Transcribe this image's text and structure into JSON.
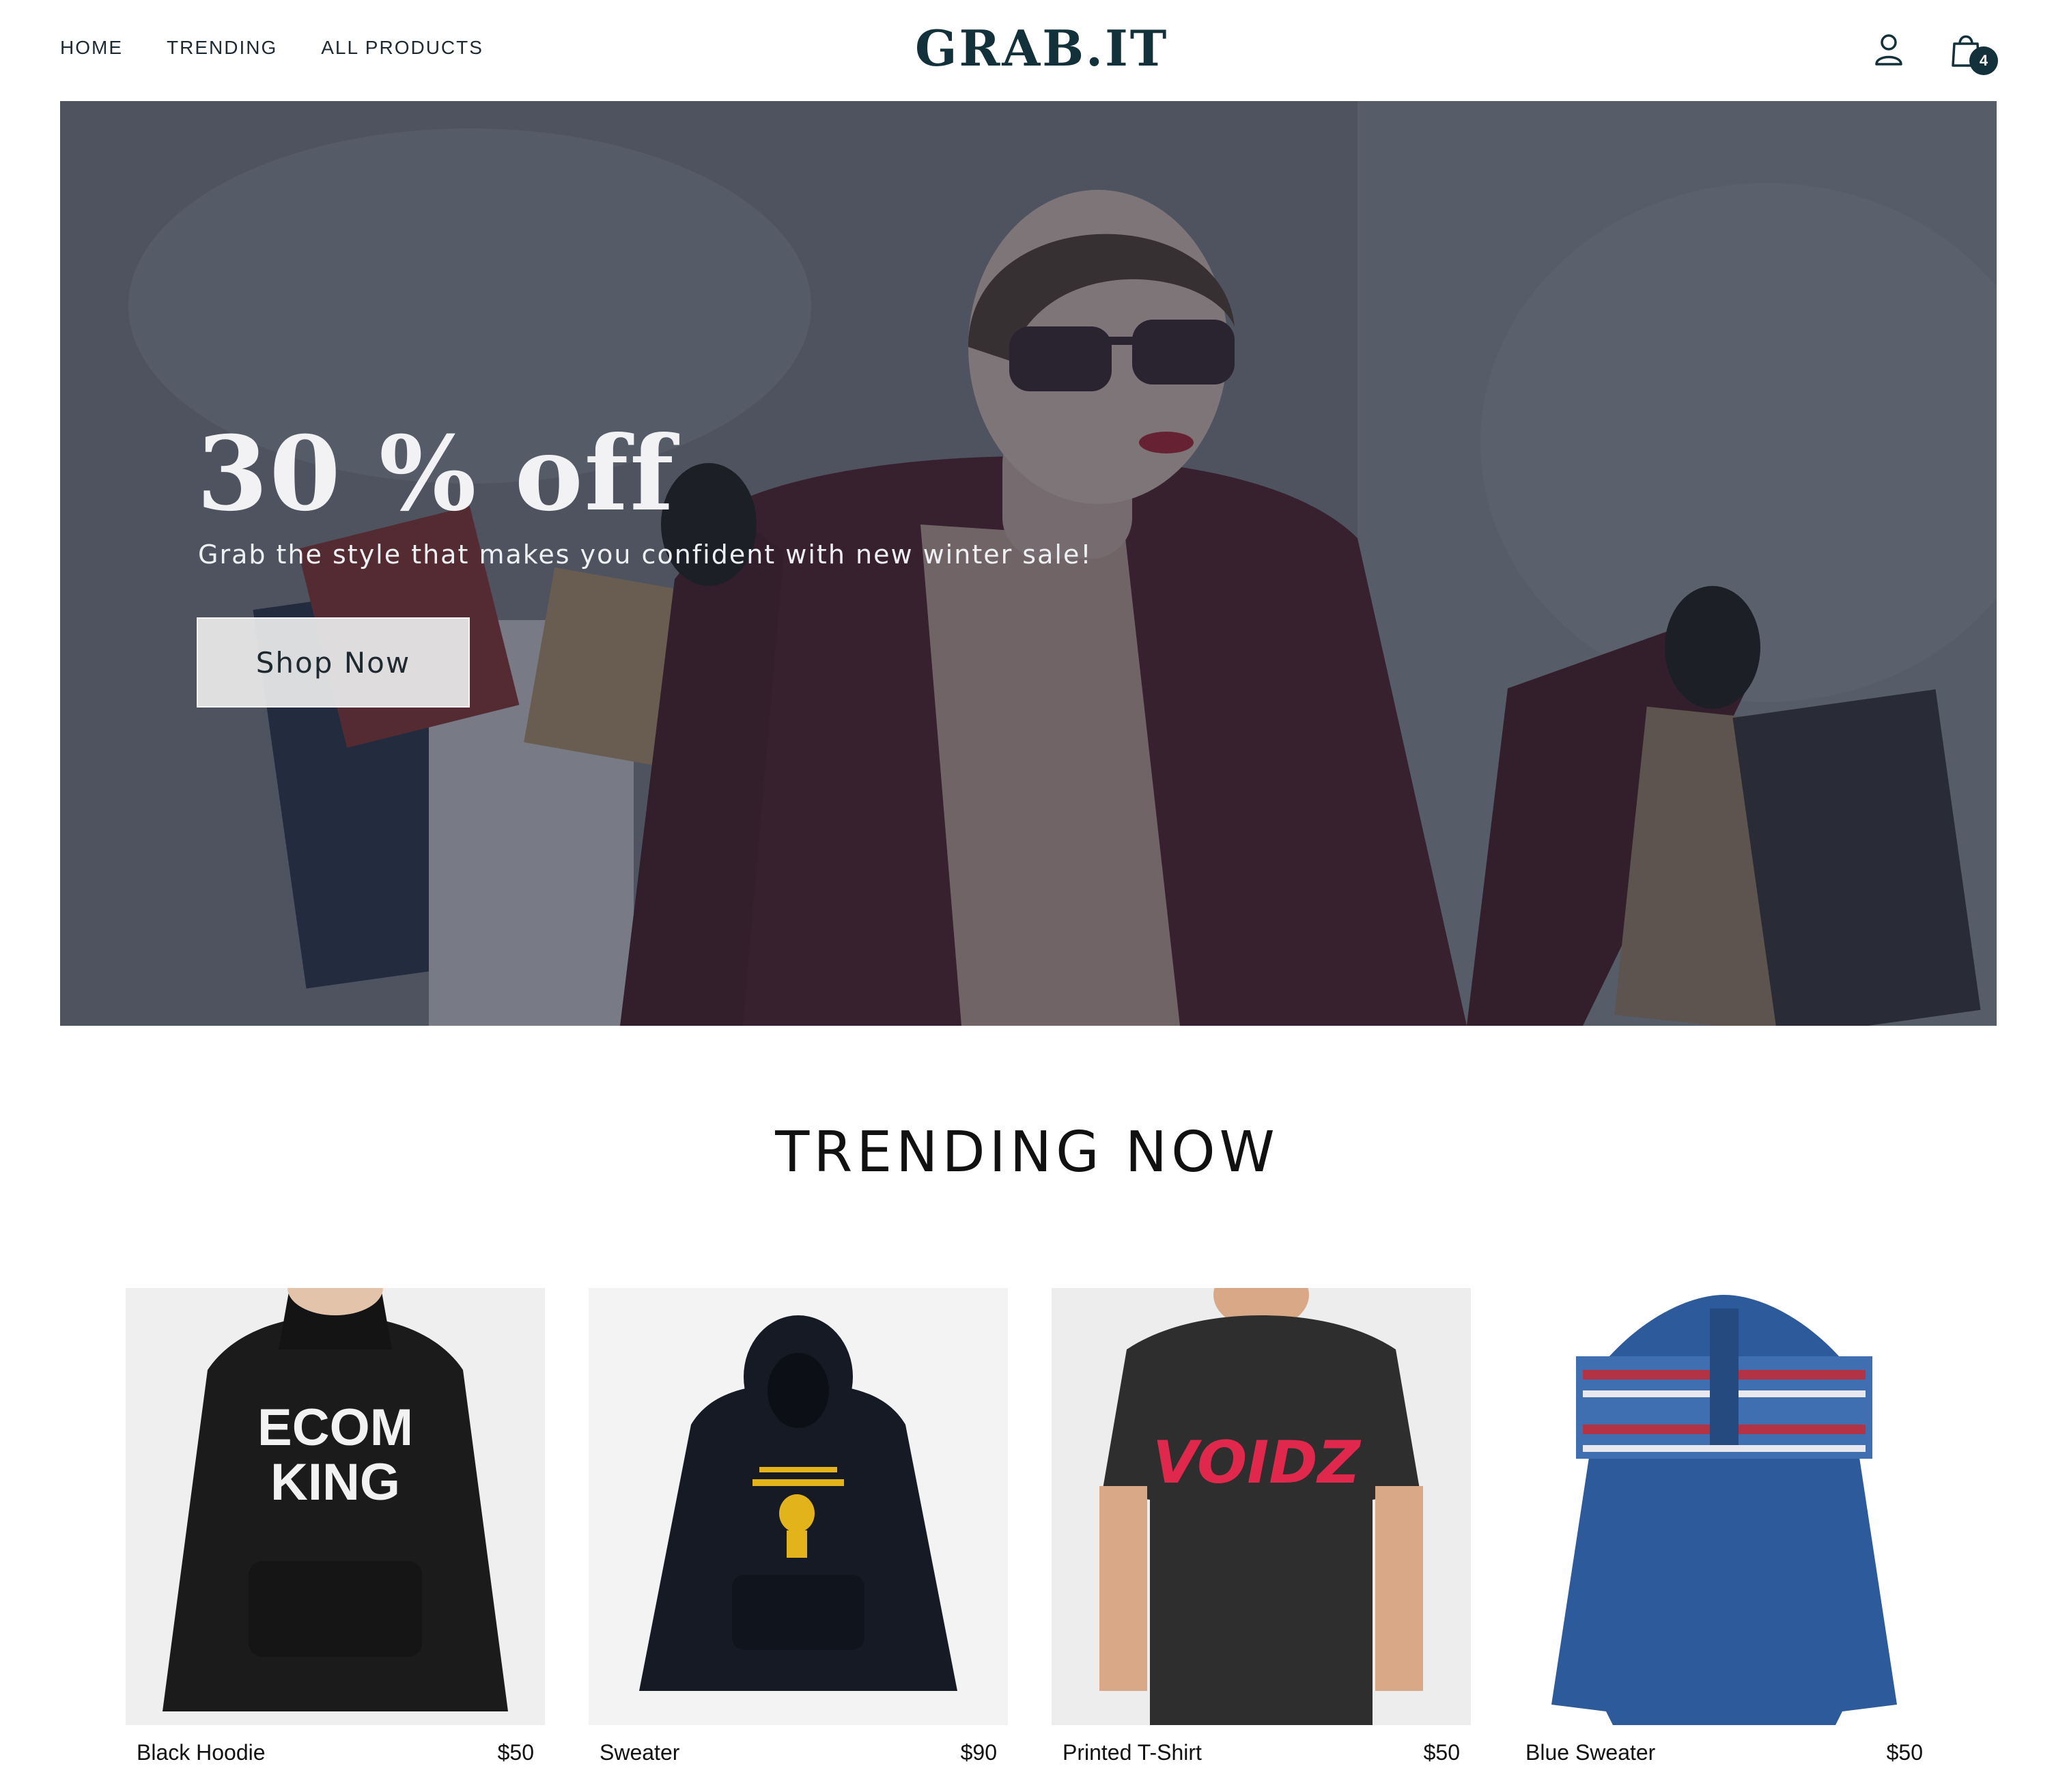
{
  "header": {
    "nav": [
      "HOME",
      "TRENDING",
      "ALL PRODUCTS"
    ],
    "logo": "GRAB.IT",
    "cart_count": "4",
    "icons": {
      "user": "user-icon",
      "cart": "shopping-bag-icon"
    }
  },
  "hero": {
    "title": "30 % off",
    "subtitle": "Grab the style that makes you confident with new winter sale!",
    "button": "Shop Now"
  },
  "trending": {
    "title": "TRENDING NOW",
    "products": [
      {
        "name": "Black Hoodie",
        "price": "$50",
        "print": [
          "ECOM",
          "KING"
        ]
      },
      {
        "name": "Sweater",
        "price": "$90"
      },
      {
        "name": "Printed T-Shirt",
        "price": "$50",
        "print": [
          "VOIDZ"
        ]
      },
      {
        "name": "Blue Sweater",
        "price": "$50"
      }
    ]
  },
  "colors": {
    "brand": "#12313b",
    "hero_overlay": "#282c3a"
  }
}
